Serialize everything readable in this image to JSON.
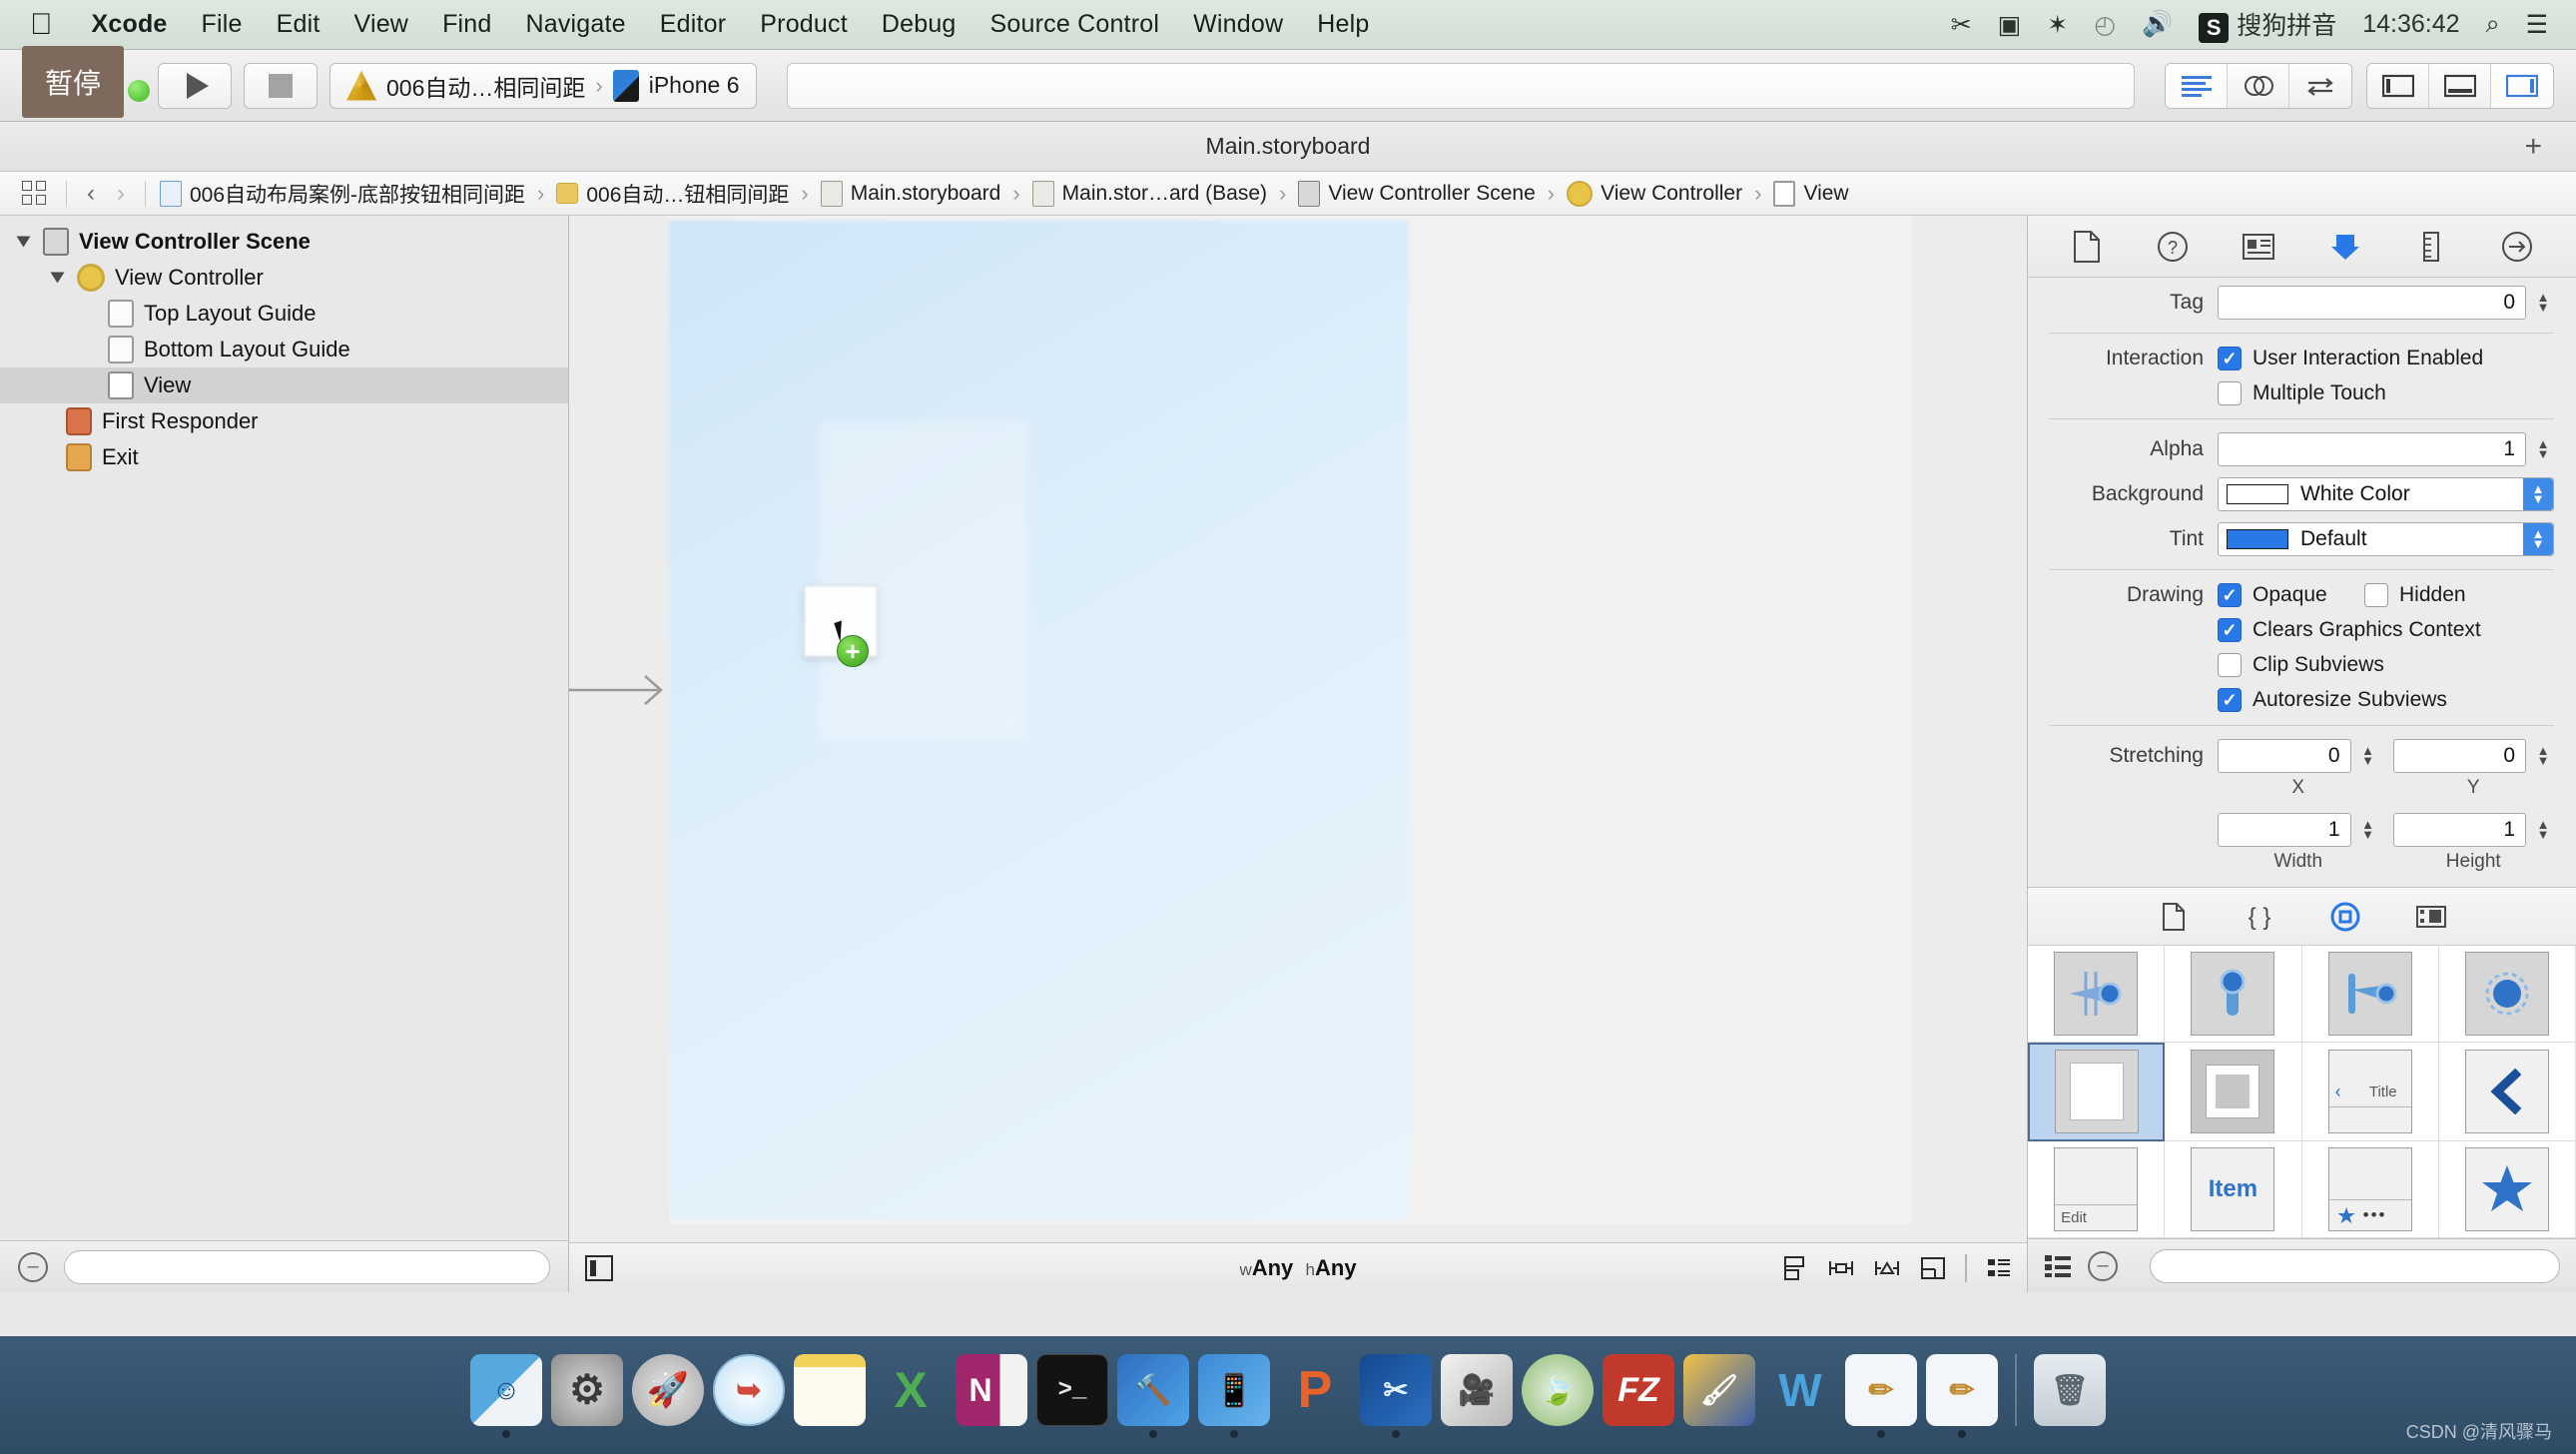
{
  "menubar": {
    "apple": "",
    "items": [
      {
        "label": "Xcode",
        "bold": true
      },
      {
        "label": "File",
        "bold": false
      },
      {
        "label": "Edit",
        "bold": false
      },
      {
        "label": "View",
        "bold": false
      },
      {
        "label": "Find",
        "bold": false
      },
      {
        "label": "Navigate",
        "bold": false
      },
      {
        "label": "Editor",
        "bold": false
      },
      {
        "label": "Product",
        "bold": false
      },
      {
        "label": "Debug",
        "bold": false
      },
      {
        "label": "Source Control",
        "bold": false
      },
      {
        "label": "Window",
        "bold": false
      },
      {
        "label": "Help",
        "bold": false
      }
    ],
    "status": {
      "cut_icon": "✂",
      "screen_record_icon": "▣",
      "bluetooth_icon": "✶",
      "timemachine_icon": "◴",
      "volume_icon": "🔊",
      "input_badge": "S",
      "input_method": "搜狗拼音",
      "clock": "14:36:42",
      "search_icon": "⌕",
      "notification_icon": "☰"
    }
  },
  "toolbar": {
    "pause_tooltip": "暂停",
    "run_label": "Run",
    "stop_label": "Stop",
    "scheme_project": "006自动…相同间距",
    "scheme_separator": "›",
    "scheme_destination": "iPhone 6",
    "editor_segments": [
      "standard-editor",
      "assistant-editor",
      "version-editor"
    ],
    "view_segments": [
      "navigator-toggle",
      "debug-area-toggle",
      "utilities-toggle"
    ]
  },
  "titlebar": {
    "title": "Main.storyboard",
    "add_label": "+"
  },
  "jumpbar": {
    "back_label": "‹",
    "forward_label": "›",
    "crumbs": [
      {
        "label": "006自动布局案例-底部按钮相同间距",
        "icon": "doc-blue"
      },
      {
        "label": "006自动…钮相同间距",
        "icon": "folder"
      },
      {
        "label": "Main.storyboard",
        "icon": "doc-gray"
      },
      {
        "label": "Main.stor…ard (Base)",
        "icon": "doc-gray"
      },
      {
        "label": "View Controller Scene",
        "icon": "scene"
      },
      {
        "label": "View Controller",
        "icon": "vc"
      },
      {
        "label": "View",
        "icon": "view"
      }
    ]
  },
  "navigator": {
    "tree": [
      {
        "label": "View Controller Scene",
        "icon": "scene",
        "indent": 0,
        "twisty": "open",
        "bold": true,
        "selected": false
      },
      {
        "label": "View Controller",
        "icon": "vc",
        "indent": 1,
        "twisty": "open",
        "bold": false,
        "selected": false
      },
      {
        "label": "Top Layout Guide",
        "icon": "guide",
        "indent": 2,
        "twisty": "none",
        "bold": false,
        "selected": false
      },
      {
        "label": "Bottom Layout Guide",
        "icon": "guide",
        "indent": 2,
        "twisty": "none",
        "bold": false,
        "selected": false
      },
      {
        "label": "View",
        "icon": "view",
        "indent": 2,
        "twisty": "none",
        "bold": false,
        "selected": true
      },
      {
        "label": "First Responder",
        "icon": "resp",
        "indent": 1,
        "twisty": "none",
        "bold": false,
        "selected": false
      },
      {
        "label": "Exit",
        "icon": "exit",
        "indent": 1,
        "twisty": "none",
        "bold": false,
        "selected": false
      }
    ],
    "filter_placeholder": "",
    "minus_label": "–"
  },
  "canvas": {
    "size_class_w_prefix": "w",
    "size_class_w": "Any",
    "size_class_h_prefix": "h",
    "size_class_h": "Any",
    "drop_badge": "+",
    "align_icons": [
      "align-button",
      "pin-button",
      "resolve-issues-button",
      "resizing-behavior-button"
    ],
    "device_bg_hex": "#dbeefb"
  },
  "inspector": {
    "tabs": [
      "file-inspector",
      "quick-help-inspector",
      "identity-inspector",
      "attributes-inspector",
      "size-inspector",
      "connections-inspector"
    ],
    "active_tab_index": 3,
    "fields": {
      "tag_label": "Tag",
      "tag_value": "0",
      "interaction_label": "Interaction",
      "user_interaction_enabled": "User Interaction Enabled",
      "user_interaction_enabled_checked": true,
      "multiple_touch": "Multiple Touch",
      "multiple_touch_checked": false,
      "alpha_label": "Alpha",
      "alpha_value": "1",
      "background_label": "Background",
      "background_value": "White Color",
      "background_swatch_hex": "#ffffff",
      "tint_label": "Tint",
      "tint_value": "Default",
      "tint_swatch_hex": "#2878e8",
      "drawing_label": "Drawing",
      "opaque": "Opaque",
      "opaque_checked": true,
      "hidden": "Hidden",
      "hidden_checked": false,
      "clears_graphics_context": "Clears Graphics Context",
      "clears_graphics_context_checked": true,
      "clip_subviews": "Clip Subviews",
      "clip_subviews_checked": false,
      "autoresize_subviews": "Autoresize Subviews",
      "autoresize_subviews_checked": true,
      "stretching_label": "Stretching",
      "stretching_x": "0",
      "stretching_y": "0",
      "stretching_width": "1",
      "stretching_height": "1",
      "x_sub": "X",
      "y_sub": "Y",
      "width_sub": "Width",
      "height_sub": "Height"
    }
  },
  "library": {
    "tabs": [
      "file-template-library",
      "code-snippet-library",
      "object-library",
      "media-library"
    ],
    "active_tab_index": 2,
    "items": [
      {
        "name": "push-segue",
        "kind": "segue-icon",
        "label": ""
      },
      {
        "name": "view-controller-object",
        "kind": "pin-icon",
        "label": ""
      },
      {
        "name": "relationship-segue",
        "kind": "relationship-icon",
        "label": ""
      },
      {
        "name": "exit-object",
        "kind": "circle-dashed-icon",
        "label": ""
      },
      {
        "name": "view-object",
        "kind": "view-tile",
        "label": "",
        "selected": true
      },
      {
        "name": "container-view-object",
        "kind": "container-tile",
        "label": ""
      },
      {
        "name": "navigation-bar-object",
        "kind": "navbar-tile",
        "label": "Title"
      },
      {
        "name": "navigation-item-object",
        "kind": "chevron-tile",
        "label": ""
      },
      {
        "name": "toolbar-object",
        "kind": "toolbar-tile",
        "label": "Edit"
      },
      {
        "name": "bar-button-item-object",
        "kind": "baritem-tile",
        "label": "Item"
      },
      {
        "name": "tab-bar-object",
        "kind": "tabbar-tile",
        "label": ""
      },
      {
        "name": "tab-bar-item-object",
        "kind": "star-tile",
        "label": ""
      }
    ],
    "search_placeholder": ""
  },
  "dock": {
    "items": [
      {
        "name": "finder",
        "glyph": "☺",
        "bg": "#6fb8ea",
        "running": true
      },
      {
        "name": "system-preferences",
        "glyph": "⚙",
        "bg": "#8d8d8d",
        "running": false
      },
      {
        "name": "launchpad",
        "glyph": "🚀",
        "bg": "#b9b9b9",
        "running": false
      },
      {
        "name": "safari",
        "glyph": "🧭",
        "bg": "#dff0fb",
        "running": false
      },
      {
        "name": "notes",
        "glyph": "🗒",
        "bg": "#f7e9a8",
        "running": false
      },
      {
        "name": "microsoft-excel",
        "glyph": "X",
        "bg": "#4fae54",
        "running": false
      },
      {
        "name": "microsoft-onenote",
        "glyph": "N",
        "bg": "#a0276b",
        "running": false
      },
      {
        "name": "terminal",
        "glyph": ">_",
        "bg": "#1b1b1b",
        "running": false
      },
      {
        "name": "xcode",
        "glyph": "🔨",
        "bg": "#3c82d6",
        "running": true
      },
      {
        "name": "simulator",
        "glyph": "📱",
        "bg": "#4a90d9",
        "running": true
      },
      {
        "name": "instruments",
        "glyph": "P",
        "bg": "#e8622a",
        "running": false
      },
      {
        "name": "snipaste",
        "glyph": "✂",
        "bg": "#1d5fa8",
        "running": true
      },
      {
        "name": "screenflow",
        "glyph": "🎬",
        "bg": "#c8c8c8",
        "running": false
      },
      {
        "name": "ftp-client",
        "glyph": "🍃",
        "bg": "#7fb85a",
        "running": false
      },
      {
        "name": "filezilla",
        "glyph": "FZ",
        "bg": "#c0392b",
        "running": false
      },
      {
        "name": "paintbrush-app",
        "glyph": "🖌",
        "bg": "#e8a33d",
        "running": false
      },
      {
        "name": "wps-writer",
        "glyph": "W",
        "bg": "#3c9ad6",
        "running": false
      },
      {
        "name": "xcode-doc-1",
        "glyph": "✒",
        "bg": "#eef3f7",
        "running": true
      },
      {
        "name": "xcode-doc-2",
        "glyph": "✒",
        "bg": "#eef3f7",
        "running": true
      },
      {
        "name": "trash",
        "glyph": "🗑",
        "bg": "#cfd6db",
        "running": false
      }
    ]
  },
  "watermark": "CSDN @清风骤马"
}
